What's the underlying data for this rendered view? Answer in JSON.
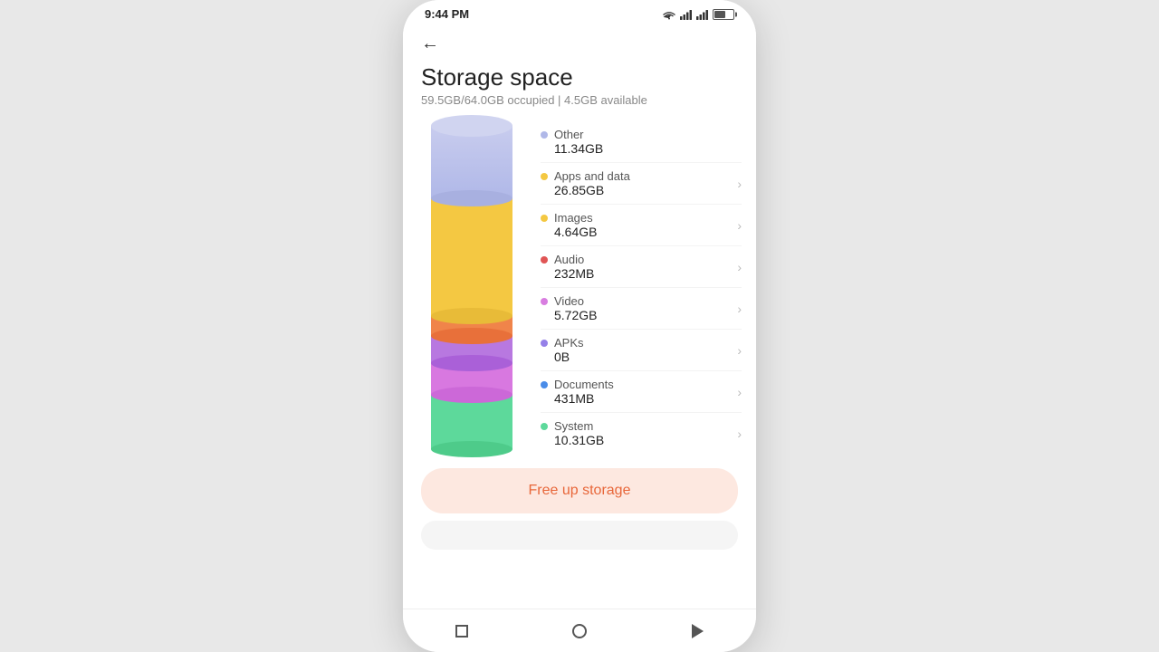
{
  "statusBar": {
    "time": "9:44 PM",
    "batteryIcon": "battery"
  },
  "header": {
    "backLabel": "←",
    "title": "Storage space",
    "subtitle": "59.5GB/64.0GB occupied | 4.5GB available"
  },
  "chart": {
    "segments": [
      {
        "color": "#5dd99b",
        "height": 60,
        "label": "System"
      },
      {
        "color": "#d97de0",
        "height": 30,
        "label": "APKs"
      },
      {
        "color": "#e67de0",
        "height": 35,
        "label": "Video (bottom)"
      },
      {
        "color": "#f4824a",
        "height": 22,
        "label": "Audio"
      },
      {
        "color": "#f4c842",
        "height": 130,
        "label": "Apps and data"
      },
      {
        "color": "#b0b8e8",
        "height": 80,
        "label": "Other"
      }
    ]
  },
  "legend": [
    {
      "id": "other",
      "dot": "#b0b8e8",
      "name": "Other",
      "value": "11.34GB",
      "hasArrow": false
    },
    {
      "id": "apps",
      "dot": "#f4c842",
      "name": "Apps and data",
      "value": "26.85GB",
      "hasArrow": true
    },
    {
      "id": "images",
      "dot": "#f4c842",
      "name": "Images",
      "value": "4.64GB",
      "hasArrow": true
    },
    {
      "id": "audio",
      "dot": "#e05555",
      "name": "Audio",
      "value": "232MB",
      "hasArrow": true
    },
    {
      "id": "video",
      "dot": "#d87de0",
      "name": "Video",
      "value": "5.72GB",
      "hasArrow": true
    },
    {
      "id": "apks",
      "dot": "#9580e8",
      "name": "APKs",
      "value": "0B",
      "hasArrow": true
    },
    {
      "id": "documents",
      "dot": "#4a8ce8",
      "name": "Documents",
      "value": "431MB",
      "hasArrow": true
    },
    {
      "id": "system",
      "dot": "#5dd99b",
      "name": "System",
      "value": "10.31GB",
      "hasArrow": true
    }
  ],
  "freeUpBtn": {
    "label": "Free up storage"
  },
  "nav": {
    "square": "square-button",
    "circle": "home-button",
    "back": "back-button"
  }
}
